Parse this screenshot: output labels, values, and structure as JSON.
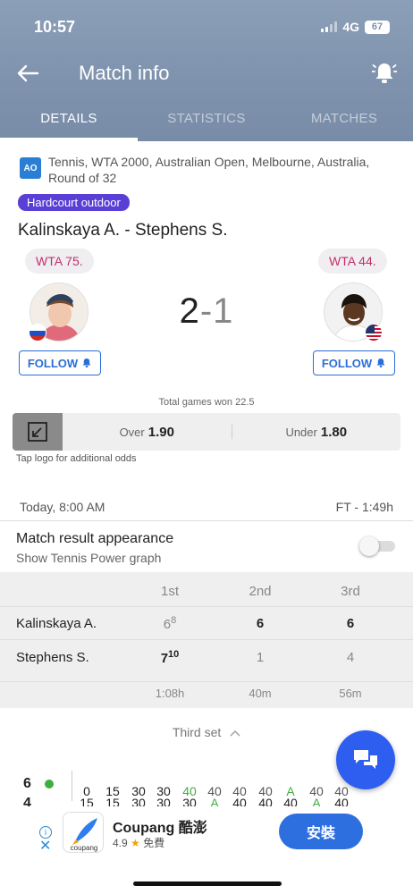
{
  "status": {
    "time": "10:57",
    "network": "4G",
    "battery": "67"
  },
  "header": {
    "title": "Match info",
    "back_icon": "arrow-left-icon",
    "bell_icon": "bell-icon"
  },
  "tabs": [
    {
      "label": "DETAILS",
      "active": true
    },
    {
      "label": "STATISTICS",
      "active": false
    },
    {
      "label": "MATCHES",
      "active": false
    }
  ],
  "tournament": {
    "logo_text": "AO",
    "info": "Tennis, WTA 2000, Australian Open, Melbourne, Australia, Round of 32",
    "surface": "Hardcourt outdoor"
  },
  "match": {
    "title": "Kalinskaya A. - Stephens S.",
    "home": {
      "rank": "WTA 75.",
      "follow": "FOLLOW",
      "flag": "russia"
    },
    "away": {
      "rank": "WTA 44.",
      "follow": "FOLLOW",
      "flag": "usa"
    },
    "score_home": "2",
    "score_sep": "-",
    "score_away": "1"
  },
  "odds": {
    "total_label": "Total games won 22.5",
    "over_label": "Over",
    "over_value": "1.90",
    "under_label": "Under",
    "under_value": "1.80",
    "tap_text": "Tap logo for additional odds"
  },
  "timing": {
    "date": "Today, 8:00 AM",
    "status": "FT - 1:49h"
  },
  "appearance": {
    "title": "Match result appearance",
    "subtitle": "Show Tennis Power graph",
    "toggle_on": false
  },
  "sets": {
    "headers": [
      "1st",
      "2nd",
      "3rd"
    ],
    "players": [
      {
        "name": "Kalinskaya A.",
        "s1": "6",
        "s1_tb": "8",
        "s2": "6",
        "s3": "6"
      },
      {
        "name": "Stephens S.",
        "s1": "7",
        "s1_tb": "10",
        "s2": "1",
        "s3": "4"
      }
    ],
    "durations": [
      "1:08h",
      "40m",
      "56m"
    ]
  },
  "third_set": {
    "label": "Third set"
  },
  "pbp": {
    "games": "6",
    "games_next": "4",
    "points": [
      "0",
      "15",
      "30",
      "30",
      "40",
      "40",
      "40",
      "40",
      "A",
      "40",
      "40"
    ],
    "points_next": [
      "15",
      "15",
      "30",
      "30",
      "30",
      "A",
      "40",
      "40",
      "40",
      "A",
      "40"
    ]
  },
  "ad": {
    "name": "Coupang 酷澎",
    "rating": "4.9",
    "price": "免費",
    "install": "安裝",
    "logo_text": "coupang"
  }
}
